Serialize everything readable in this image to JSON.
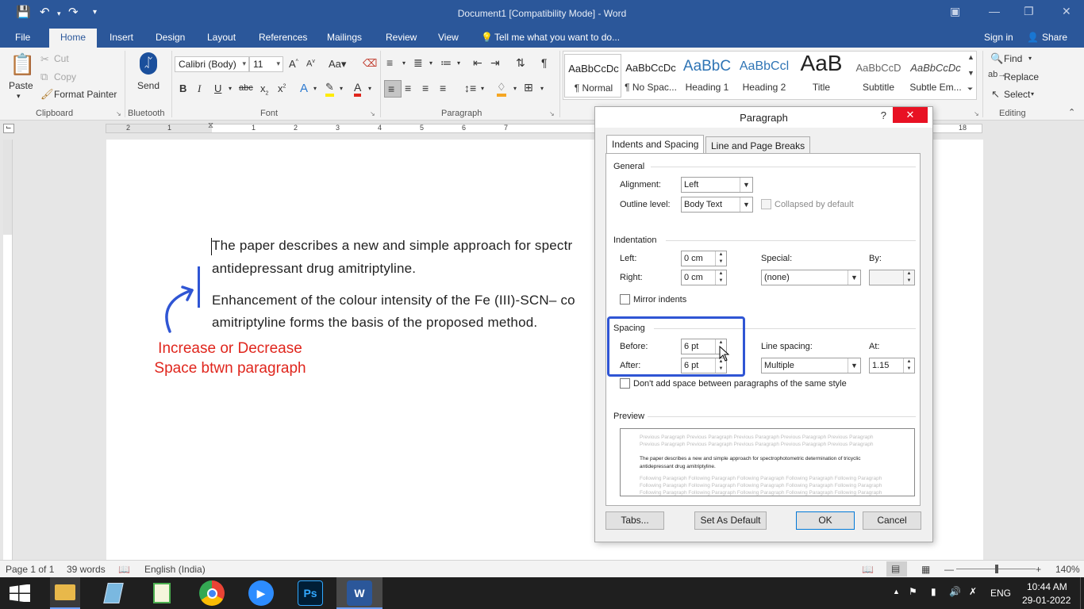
{
  "window": {
    "title": "Document1 [Compatibility Mode] - Word"
  },
  "tabs": [
    "File",
    "Home",
    "Insert",
    "Design",
    "Layout",
    "References",
    "Mailings",
    "Review",
    "View"
  ],
  "tell_me": "Tell me what you want to do...",
  "account": {
    "sign_in": "Sign in",
    "share": "Share"
  },
  "ribbon": {
    "clipboard": {
      "paste": "Paste",
      "cut": "Cut",
      "copy": "Copy",
      "format_painter": "Format Painter",
      "group": "Clipboard"
    },
    "bluetooth": {
      "send": "Send",
      "group": "Bluetooth"
    },
    "font": {
      "name": "Calibri (Body)",
      "size": "11",
      "group": "Font"
    },
    "paragraph": {
      "group": "Paragraph"
    },
    "styles": [
      {
        "preview": "AaBbCcDc",
        "name": "¶ Normal"
      },
      {
        "preview": "AaBbCcDc",
        "name": "¶ No Spac..."
      },
      {
        "preview": "AaBbC",
        "name": "Heading 1"
      },
      {
        "preview": "AaBbCcl",
        "name": "Heading 2"
      },
      {
        "preview": "AaB",
        "name": "Title"
      },
      {
        "preview": "AaBbCcD",
        "name": "Subtitle"
      },
      {
        "preview": "AaBbCcDc",
        "name": "Subtle Em..."
      }
    ],
    "editing": {
      "find": "Find",
      "replace": "Replace",
      "select": "Select",
      "group": "Editing"
    }
  },
  "ruler": {
    "h_numbers": [
      "2",
      "1",
      "1",
      "2",
      "3",
      "4",
      "5",
      "6",
      "7",
      "18"
    ]
  },
  "document": {
    "line1": "The paper describes a new and simple approach for spectr",
    "line2": "antidepressant drug amitriptyline.",
    "line3": "Enhancement of the colour intensity of the Fe (III)-SCN– co",
    "line4": "amitriptyline forms the basis of the proposed method.",
    "annotation_line1": "Increase or Decrease",
    "annotation_line2": "Space btwn paragraph"
  },
  "dialog": {
    "title": "Paragraph",
    "help": "?",
    "tabs": [
      "Indents and Spacing",
      "Line and Page Breaks"
    ],
    "general": {
      "heading": "General",
      "alignment_label": "Alignment:",
      "alignment_value": "Left",
      "outline_label": "Outline level:",
      "outline_value": "Body Text",
      "collapsed_label": "Collapsed by default"
    },
    "indentation": {
      "heading": "Indentation",
      "left_label": "Left:",
      "left_value": "0 cm",
      "right_label": "Right:",
      "right_value": "0 cm",
      "special_label": "Special:",
      "special_value": "(none)",
      "by_label": "By:",
      "by_value": "",
      "mirror_label": "Mirror indents"
    },
    "spacing": {
      "heading": "Spacing",
      "before_label": "Before:",
      "before_value": "6 pt",
      "after_label": "After:",
      "after_value": "6 pt",
      "line_spacing_label": "Line spacing:",
      "line_spacing_value": "Multiple",
      "at_label": "At:",
      "at_value": "1.15",
      "dont_add_label": "Don't add space between paragraphs of the same style"
    },
    "preview": {
      "heading": "Preview",
      "prev_lines": [
        "Previous Paragraph Previous Paragraph Previous Paragraph Previous Paragraph Previous Paragraph",
        "Previous Paragraph Previous Paragraph Previous Paragraph Previous Paragraph Previous Paragraph"
      ],
      "current_lines": [
        "The paper describes a new and simple approach for spectrophotometric determination of tricyclic",
        "antidepressant drug amitriptyline."
      ],
      "follow_lines": [
        "Following Paragraph Following Paragraph Following Paragraph Following Paragraph Following Paragraph",
        "Following Paragraph Following Paragraph Following Paragraph Following Paragraph Following Paragraph",
        "Following Paragraph Following Paragraph Following Paragraph Following Paragraph Following Paragraph"
      ]
    },
    "buttons": {
      "tabs": "Tabs...",
      "set_default": "Set As Default",
      "ok": "OK",
      "cancel": "Cancel"
    }
  },
  "status": {
    "page": "Page 1 of 1",
    "words": "39 words",
    "language": "English (India)",
    "zoom": "140%"
  },
  "taskbar": {
    "lang": "ENG",
    "time": "10:44 AM",
    "date": "29-01-2022"
  },
  "colors": {
    "word_blue": "#2b579a",
    "annotation_red": "#e0261d",
    "highlight_blue": "#2f55d4",
    "close_red": "#e81123"
  }
}
